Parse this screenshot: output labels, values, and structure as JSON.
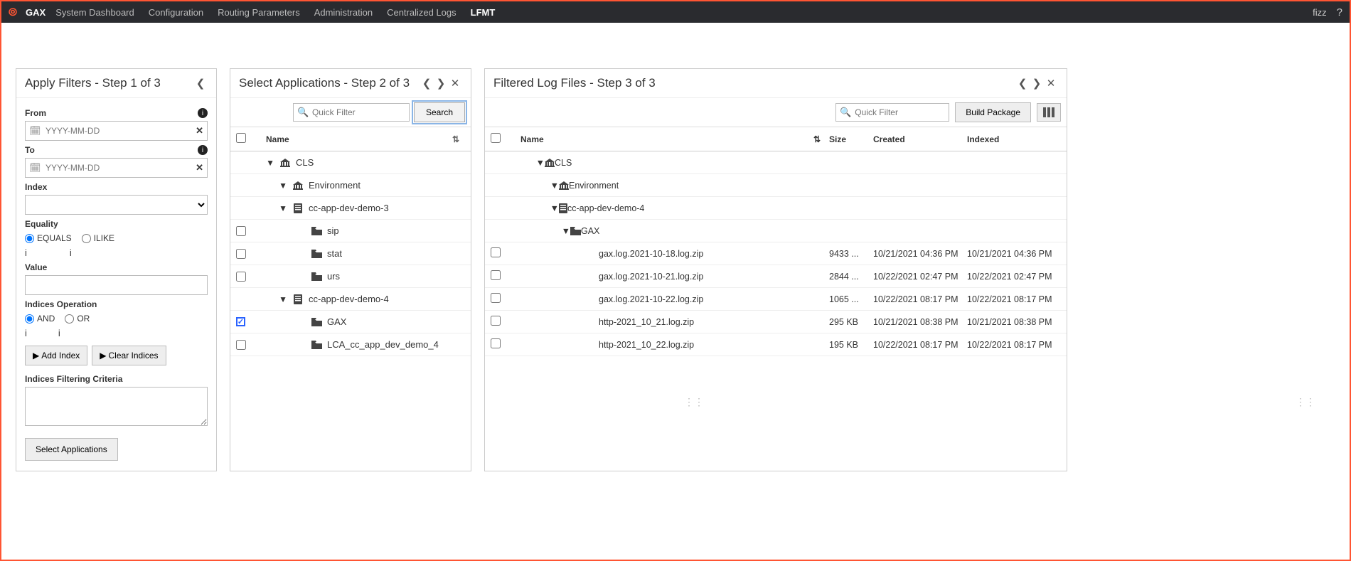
{
  "header": {
    "brand": "GAX",
    "nav": [
      "System Dashboard",
      "Configuration",
      "Routing Parameters",
      "Administration",
      "Centralized Logs",
      "LFMT"
    ],
    "active_index": 5,
    "user": "fizz"
  },
  "panel1": {
    "title": "Apply Filters - Step 1 of 3",
    "from_label": "From",
    "from_placeholder": "YYYY-MM-DD",
    "to_label": "To",
    "to_placeholder": "YYYY-MM-DD",
    "index_label": "Index",
    "equality_label": "Equality",
    "equality_options": [
      "EQUALS",
      "ILIKE"
    ],
    "equality_selected": "EQUALS",
    "value_label": "Value",
    "indices_op_label": "Indices Operation",
    "indices_op_options": [
      "AND",
      "OR"
    ],
    "indices_op_selected": "AND",
    "add_index_btn": "Add Index",
    "clear_indices_btn": "Clear Indices",
    "indices_filtering_label": "Indices Filtering Criteria",
    "select_apps_btn": "Select Applications"
  },
  "panel2": {
    "title": "Select Applications - Step 2 of 3",
    "quick_filter_placeholder": "Quick Filter",
    "search_btn": "Search",
    "name_header": "Name",
    "tree": [
      {
        "indent": 24,
        "arrow": true,
        "icon": "bank",
        "label": "CLS",
        "checkbox": false
      },
      {
        "indent": 42,
        "arrow": true,
        "icon": "bank",
        "label": "Environment",
        "checkbox": false
      },
      {
        "indent": 42,
        "arrow": true,
        "icon": "server",
        "label": "cc-app-dev-demo-3",
        "checkbox": false
      },
      {
        "indent": 68,
        "arrow": false,
        "icon": "folder",
        "label": "sip",
        "checkbox": true,
        "checked": false
      },
      {
        "indent": 68,
        "arrow": false,
        "icon": "folder",
        "label": "stat",
        "checkbox": true,
        "checked": false
      },
      {
        "indent": 68,
        "arrow": false,
        "icon": "folder",
        "label": "urs",
        "checkbox": true,
        "checked": false
      },
      {
        "indent": 42,
        "arrow": true,
        "icon": "server",
        "label": "cc-app-dev-demo-4",
        "checkbox": false
      },
      {
        "indent": 68,
        "arrow": false,
        "icon": "folder",
        "label": "GAX",
        "checkbox": true,
        "checked": true
      },
      {
        "indent": 68,
        "arrow": false,
        "icon": "folder",
        "label": "LCA_cc_app_dev_demo_4",
        "checkbox": true,
        "checked": false
      }
    ]
  },
  "panel3": {
    "title": "Filtered Log Files - Step 3 of 3",
    "quick_filter_placeholder": "Quick Filter",
    "build_btn": "Build Package",
    "headers": {
      "name": "Name",
      "size": "Size",
      "created": "Created",
      "indexed": "Indexed"
    },
    "tree": [
      {
        "type": "node",
        "indent": 40,
        "icon": "bank",
        "label": "CLS"
      },
      {
        "type": "node",
        "indent": 60,
        "icon": "bank",
        "label": "Environment"
      },
      {
        "type": "node",
        "indent": 60,
        "icon": "server",
        "label": "cc-app-dev-demo-4"
      },
      {
        "type": "node",
        "indent": 76,
        "icon": "folder",
        "label": "GAX"
      },
      {
        "type": "file",
        "indent": 116,
        "label": "gax.log.2021-10-18.log.zip",
        "size": "9433 ...",
        "created": "10/21/2021 04:36 PM",
        "indexed": "10/21/2021 04:36 PM"
      },
      {
        "type": "file",
        "indent": 116,
        "label": "gax.log.2021-10-21.log.zip",
        "size": "2844 ...",
        "created": "10/22/2021 02:47 PM",
        "indexed": "10/22/2021 02:47 PM"
      },
      {
        "type": "file",
        "indent": 116,
        "label": "gax.log.2021-10-22.log.zip",
        "size": "1065 ...",
        "created": "10/22/2021 08:17 PM",
        "indexed": "10/22/2021 08:17 PM"
      },
      {
        "type": "file",
        "indent": 116,
        "label": "http-2021_10_21.log.zip",
        "size": "295 KB",
        "created": "10/21/2021 08:38 PM",
        "indexed": "10/21/2021 08:38 PM"
      },
      {
        "type": "file",
        "indent": 116,
        "label": "http-2021_10_22.log.zip",
        "size": "195 KB",
        "created": "10/22/2021 08:17 PM",
        "indexed": "10/22/2021 08:17 PM"
      }
    ]
  }
}
